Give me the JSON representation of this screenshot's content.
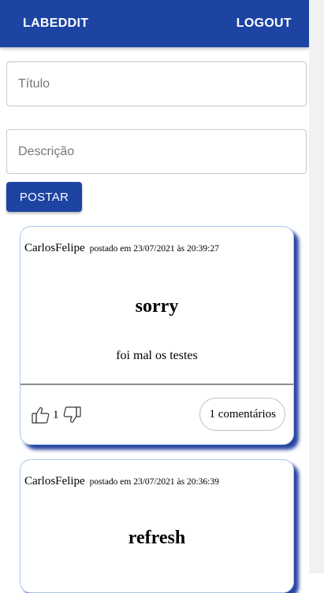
{
  "header": {
    "brand": "LABEDDIT",
    "logout_label": "LOGOUT"
  },
  "form": {
    "title_placeholder": "Título",
    "description_placeholder": "Descrição",
    "submit_label": "POSTAR"
  },
  "posts": [
    {
      "username": "CarlosFelipe",
      "meta": "postado em 23/07/2021 às 20:39:27",
      "title": "sorry",
      "body": "foi mal os testes",
      "votes": "1",
      "comments_label": "1 comentários"
    },
    {
      "username": "CarlosFelipe",
      "meta": "postado em 23/07/2021 às 20:36:39",
      "title": "refresh"
    }
  ],
  "colors": {
    "primary": "#1d44a3",
    "card_border": "#a8c8ea",
    "card_shadow": "#2844a0"
  }
}
